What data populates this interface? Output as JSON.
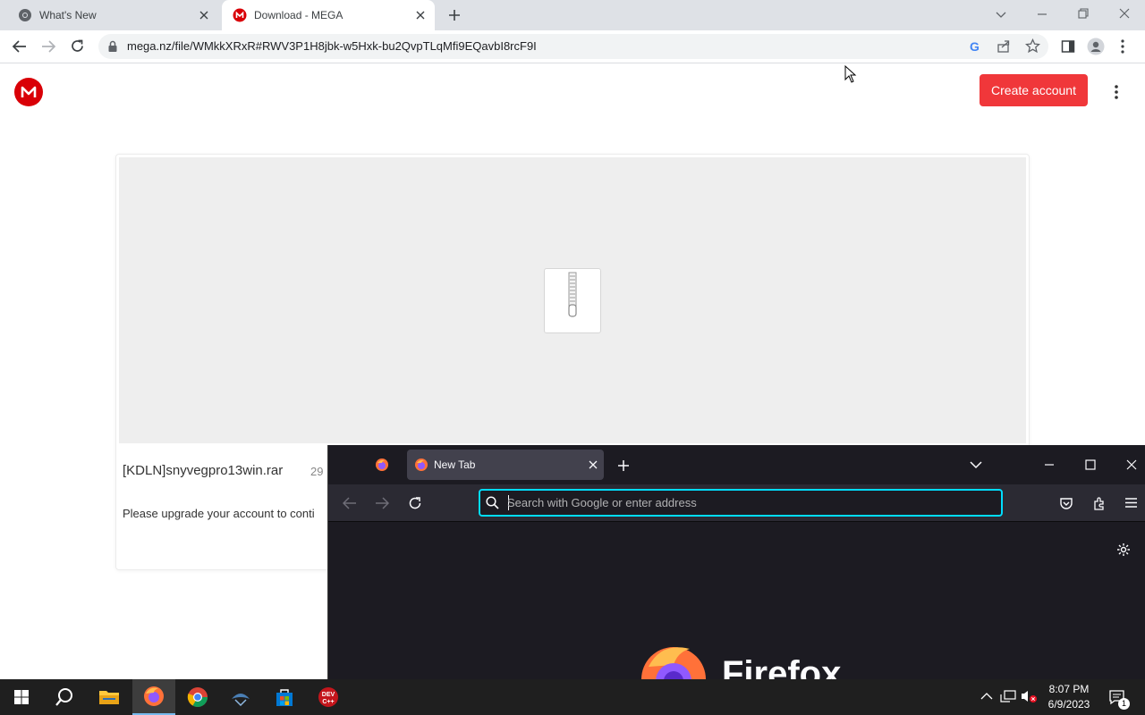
{
  "chrome": {
    "tabs": [
      {
        "label": "What's New",
        "active": false
      },
      {
        "label": "Download - MEGA",
        "active": true
      }
    ],
    "url": "mega.nz/file/WMkkXRxR#RWV3P1H8jbk-w5Hxk-bu2QvpTLqMfi9EQavbI8rcF9I"
  },
  "mega": {
    "logo_letter": "M",
    "create_account_label": "Create account",
    "file_name": "[KDLN]snyvegpro13win.rar",
    "file_size_partial": "29",
    "upgrade_message": "Please upgrade your account to conti"
  },
  "firefox": {
    "tab_label": "New Tab",
    "search_placeholder": "Search with Google or enter address",
    "wordmark": "Firefox"
  },
  "taskbar": {
    "time": "8:07 PM",
    "date": "6/9/2023",
    "notification_count": "1",
    "devcpp_label": "DEV C++"
  },
  "colors": {
    "mega_red": "#d90007",
    "create_button": "#f0373a",
    "firefox_bg": "#1c1b22",
    "firefox_focus": "#00ddff",
    "taskbar_bg": "#1f1f1f"
  }
}
